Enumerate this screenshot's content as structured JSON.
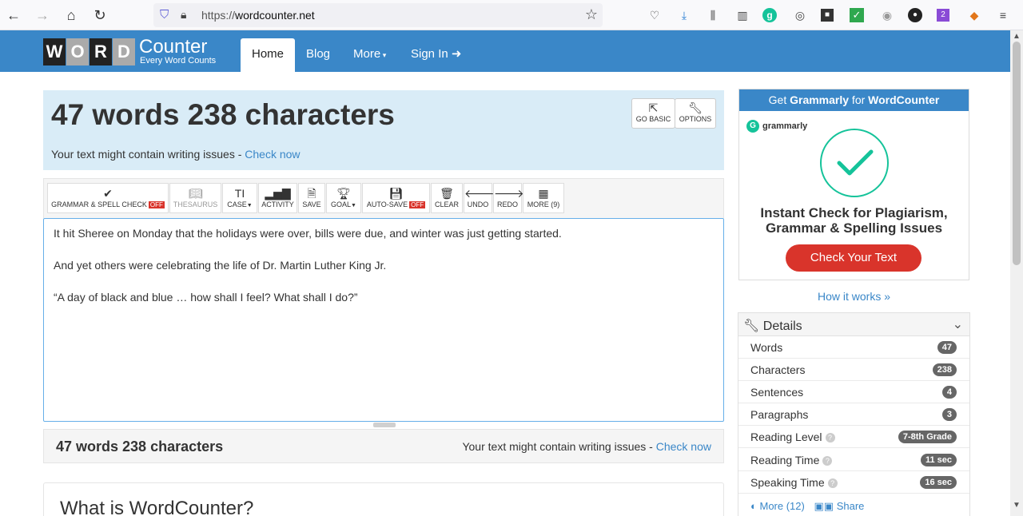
{
  "browser": {
    "url_prefix": "https://",
    "url_host": "wordcounter.net"
  },
  "logo": {
    "letters": [
      "W",
      "O",
      "R",
      "D"
    ],
    "counter": "Counter",
    "tagline": "Every Word Counts"
  },
  "nav": {
    "home": "Home",
    "blog": "Blog",
    "more": "More",
    "signin": "Sign In"
  },
  "stats": {
    "title": "47 words 238 characters",
    "issue_text": "Your text might contain writing issues - ",
    "check_now": "Check now",
    "go_basic": "GO BASIC",
    "options": "OPTIONS"
  },
  "toolbar": {
    "grammar": "GRAMMAR & SPELL CHECK",
    "off": "OFF",
    "thesaurus": "THESAURUS",
    "case": "CASE",
    "activity": "ACTIVITY",
    "save": "SAVE",
    "goal": "GOAL",
    "autosave": "AUTO-SAVE",
    "clear": "CLEAR",
    "undo": "UNDO",
    "redo": "REDO",
    "more": "MORE (9)"
  },
  "editor": {
    "lines": [
      "It hit Sheree on Monday that the holidays were over, bills were due, and winter was just getting started.",
      "And yet others were celebrating the life of Dr. Martin Luther King Jr.",
      "“A day of black and blue … how shall I feel?  What shall I do?”"
    ]
  },
  "bottom": {
    "title": "47 words 238 characters",
    "issue_text": "Your text might contain writing issues - ",
    "check_now": "Check now"
  },
  "article": {
    "heading": "What is WordCounter?"
  },
  "ad": {
    "head_prefix": "Get ",
    "head_grammarly": "Grammarly",
    "head_mid": " for ",
    "head_wc": "WordCounter",
    "brand": "grammarly",
    "headline_1": "Instant Check for Plagiarism,",
    "headline_2": "Grammar & Spelling Issues",
    "cta": "Check Your Text",
    "how": "How it works »"
  },
  "details": {
    "title": "Details",
    "rows": [
      {
        "label": "Words",
        "value": "47"
      },
      {
        "label": "Characters",
        "value": "238"
      },
      {
        "label": "Sentences",
        "value": "4"
      },
      {
        "label": "Paragraphs",
        "value": "3"
      },
      {
        "label": "Reading Level",
        "value": "7-8th Grade"
      },
      {
        "label": "Reading Time",
        "value": "11 sec"
      },
      {
        "label": "Speaking Time",
        "value": "16 sec"
      }
    ],
    "more": "More (12)",
    "share": "Share"
  },
  "colors": {
    "brand_blue": "#3a87c8",
    "stats_bg": "#d9ecf7",
    "grammarly_green": "#15c39a",
    "cta_red": "#d9342b"
  }
}
